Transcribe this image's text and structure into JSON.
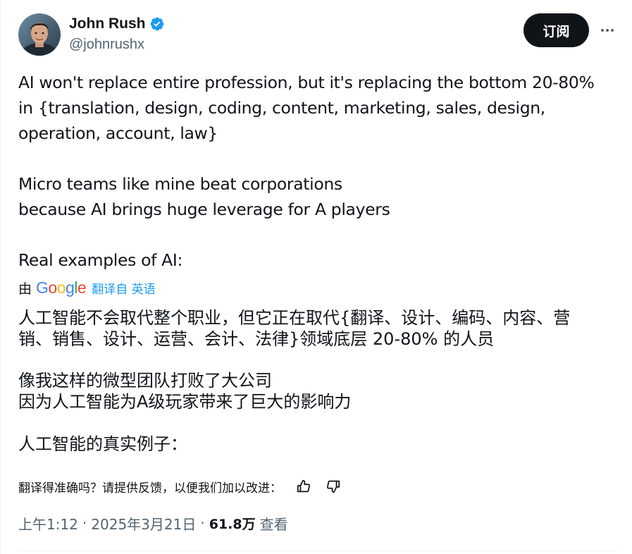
{
  "author": {
    "name": "John Rush",
    "handle": "@johnrushx",
    "verified_color": "#1d9bf0"
  },
  "actions": {
    "subscribe_label": "订阅",
    "more_icon": "more-horizontal-icon"
  },
  "tweet": {
    "lines": [
      "AI won't replace entire profession, but it's replacing the bottom 20-80%",
      "in {translation, design, coding, content, marketing, sales, design,",
      "operation, account, law}",
      "Micro teams like mine beat corporations",
      "because AI brings huge leverage for A players",
      "Real examples of AI:"
    ]
  },
  "translation": {
    "by_label": "由",
    "provider": {
      "letters": [
        "G",
        "o",
        "o",
        "g",
        "l",
        "e"
      ],
      "colors": [
        "#4285f4",
        "#ea4335",
        "#fbbc05",
        "#4285f4",
        "#34a853",
        "#ea4335"
      ]
    },
    "source_label": "翻译自 英语",
    "lines": [
      "人工智能不会取代整个职业，但它正在取代{翻译、设计、编码、内容、营",
      "销、销售、设计、运营、会计、法律}领域底层 20-80% 的人员",
      "像我这样的微型团队打败了大公司",
      "因为人工智能为A级玩家带来了巨大的影响力",
      "人工智能的真实例子："
    ],
    "feedback_prompt": "翻译得准确吗？请提供反馈，以便我们加以改进：",
    "thumbs_up_icon": "thumbs-up-icon",
    "thumbs_down_icon": "thumbs-down-icon"
  },
  "meta": {
    "time": "上午1:12",
    "separator": "·",
    "date": "2025年3月21日",
    "views_count": "61.8万",
    "views_label": "查看"
  }
}
